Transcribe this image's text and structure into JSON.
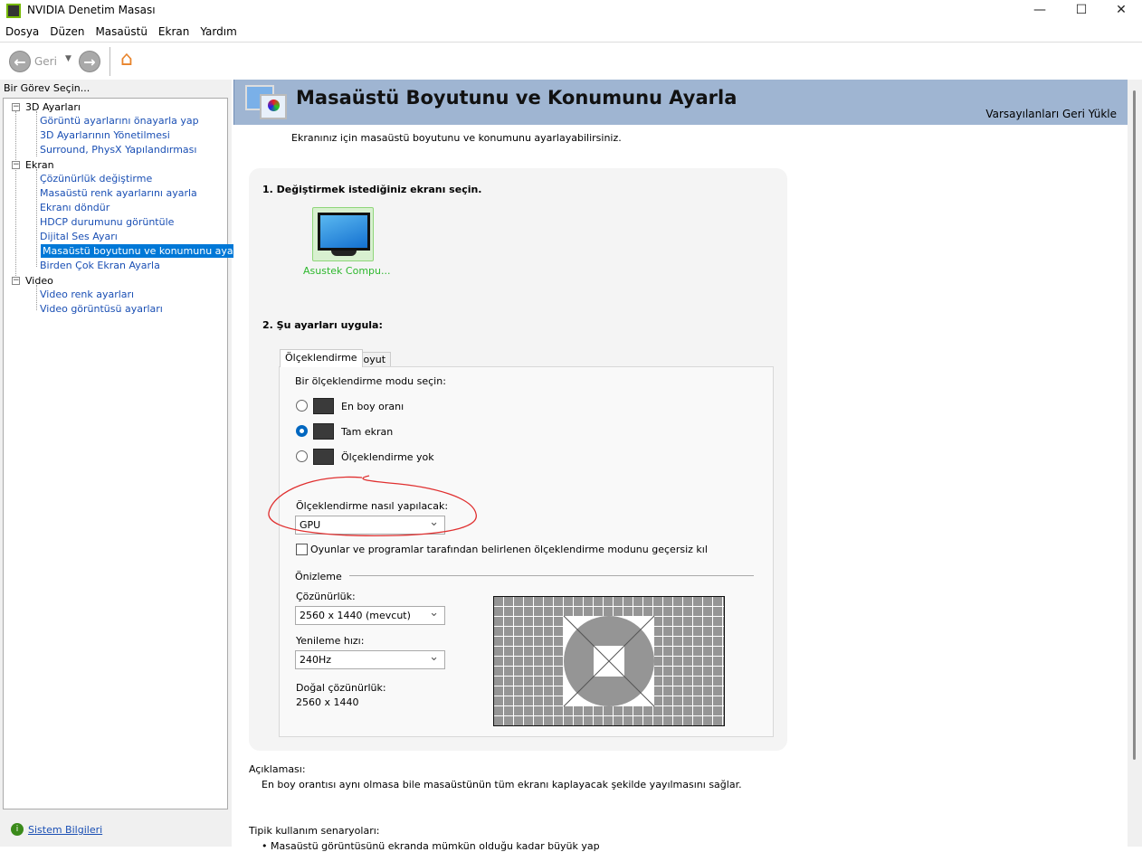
{
  "window": {
    "title": "NVIDIA Denetim Masası",
    "minimize": "—",
    "maximize": "☐",
    "close": "✕"
  },
  "menu": [
    "Dosya",
    "Düzen",
    "Masaüstü",
    "Ekran",
    "Yardım"
  ],
  "toolbar": {
    "back": "Geri"
  },
  "sidebar": {
    "title": "Bir Görev Seçin...",
    "footer_link": "Sistem Bilgileri",
    "groups": [
      {
        "label": "3D Ayarları",
        "items": [
          "Görüntü ayarlarını önayarla yap",
          "3D Ayarlarının Yönetilmesi",
          "Surround, PhysX Yapılandırması"
        ]
      },
      {
        "label": "Ekran",
        "items": [
          "Çözünürlük değiştirme",
          "Masaüstü renk ayarlarını ayarla",
          "Ekranı döndür",
          "HDCP durumunu görüntüle",
          "Dijital Ses Ayarı",
          "Masaüstü boyutunu ve konumunu ayarla",
          "Birden Çok Ekran Ayarla"
        ]
      },
      {
        "label": "Video",
        "items": [
          "Video renk ayarları",
          "Video görüntüsü ayarları"
        ]
      }
    ],
    "selected": "Masaüstü boyutunu ve konumunu ayarla"
  },
  "header": {
    "title": "Masaüstü Boyutunu ve Konumunu Ayarla",
    "restore_defaults": "Varsayılanları Geri Yükle"
  },
  "main": {
    "intro": "Ekranınız için masaüstü boyutunu ve konumunu ayarlayabilirsiniz.",
    "step1": "1. Değiştirmek istediğiniz ekranı seçin.",
    "display_name": "Asustek Compu...",
    "step2": "2. Şu ayarları uygula:",
    "tabs": [
      "Ölçeklendirme",
      "Boyut"
    ],
    "mode_prompt": "Bir ölçeklendirme modu seçin:",
    "modes": [
      {
        "label": "En boy oranı",
        "selected": false
      },
      {
        "label": "Tam ekran",
        "selected": true
      },
      {
        "label": "Ölçeklendirme yok",
        "selected": false
      }
    ],
    "scaling_label": "Ölçeklendirme nasıl yapılacak:",
    "scaling_value": "GPU",
    "override_checkbox": {
      "label": "Oyunlar ve programlar tarafından belirlenen ölçeklendirme modunu geçersiz kıl",
      "checked": false
    },
    "preview_label": "Önizleme",
    "resolution_label": "Çözünürlük:",
    "resolution_value": "2560 x 1440 (mevcut)",
    "refresh_label": "Yenileme hızı:",
    "refresh_value": "240Hz",
    "native_label": "Doğal çözünürlük:",
    "native_value": "2560 x 1440",
    "description_label": "Açıklaması:",
    "description": "En boy orantısı aynı olmasa bile masaüstünün tüm ekranı kaplayacak şekilde yayılmasını sağlar.",
    "usage_label": "Tipik kullanım senaryoları:",
    "usage_item": "• Masaüstü görüntüsünü ekranda mümkün olduğu kadar büyük yap"
  },
  "colors": {
    "selection": "#0078d7",
    "header": "#9fb5d2",
    "link": "#1a4fb4",
    "nvidia_green": "#2eb82e",
    "annotation": "#e03030"
  }
}
